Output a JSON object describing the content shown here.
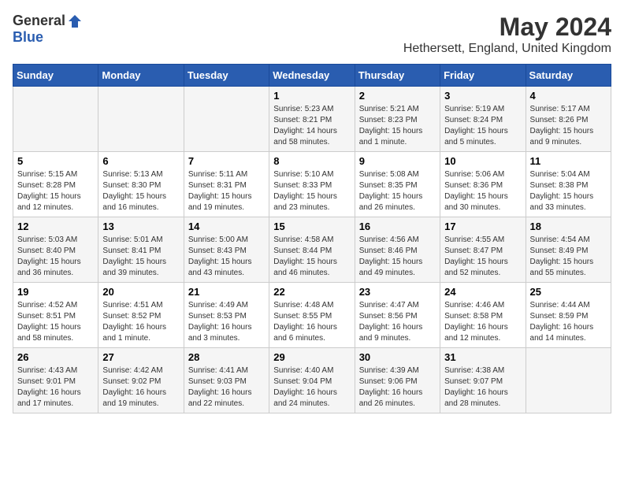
{
  "logo": {
    "general": "General",
    "blue": "Blue"
  },
  "title": "May 2024",
  "subtitle": "Hethersett, England, United Kingdom",
  "days_of_week": [
    "Sunday",
    "Monday",
    "Tuesday",
    "Wednesday",
    "Thursday",
    "Friday",
    "Saturday"
  ],
  "weeks": [
    [
      {
        "day": "",
        "detail": ""
      },
      {
        "day": "",
        "detail": ""
      },
      {
        "day": "",
        "detail": ""
      },
      {
        "day": "1",
        "detail": "Sunrise: 5:23 AM\nSunset: 8:21 PM\nDaylight: 14 hours and 58 minutes."
      },
      {
        "day": "2",
        "detail": "Sunrise: 5:21 AM\nSunset: 8:23 PM\nDaylight: 15 hours and 1 minute."
      },
      {
        "day": "3",
        "detail": "Sunrise: 5:19 AM\nSunset: 8:24 PM\nDaylight: 15 hours and 5 minutes."
      },
      {
        "day": "4",
        "detail": "Sunrise: 5:17 AM\nSunset: 8:26 PM\nDaylight: 15 hours and 9 minutes."
      }
    ],
    [
      {
        "day": "5",
        "detail": "Sunrise: 5:15 AM\nSunset: 8:28 PM\nDaylight: 15 hours and 12 minutes."
      },
      {
        "day": "6",
        "detail": "Sunrise: 5:13 AM\nSunset: 8:30 PM\nDaylight: 15 hours and 16 minutes."
      },
      {
        "day": "7",
        "detail": "Sunrise: 5:11 AM\nSunset: 8:31 PM\nDaylight: 15 hours and 19 minutes."
      },
      {
        "day": "8",
        "detail": "Sunrise: 5:10 AM\nSunset: 8:33 PM\nDaylight: 15 hours and 23 minutes."
      },
      {
        "day": "9",
        "detail": "Sunrise: 5:08 AM\nSunset: 8:35 PM\nDaylight: 15 hours and 26 minutes."
      },
      {
        "day": "10",
        "detail": "Sunrise: 5:06 AM\nSunset: 8:36 PM\nDaylight: 15 hours and 30 minutes."
      },
      {
        "day": "11",
        "detail": "Sunrise: 5:04 AM\nSunset: 8:38 PM\nDaylight: 15 hours and 33 minutes."
      }
    ],
    [
      {
        "day": "12",
        "detail": "Sunrise: 5:03 AM\nSunset: 8:40 PM\nDaylight: 15 hours and 36 minutes."
      },
      {
        "day": "13",
        "detail": "Sunrise: 5:01 AM\nSunset: 8:41 PM\nDaylight: 15 hours and 39 minutes."
      },
      {
        "day": "14",
        "detail": "Sunrise: 5:00 AM\nSunset: 8:43 PM\nDaylight: 15 hours and 43 minutes."
      },
      {
        "day": "15",
        "detail": "Sunrise: 4:58 AM\nSunset: 8:44 PM\nDaylight: 15 hours and 46 minutes."
      },
      {
        "day": "16",
        "detail": "Sunrise: 4:56 AM\nSunset: 8:46 PM\nDaylight: 15 hours and 49 minutes."
      },
      {
        "day": "17",
        "detail": "Sunrise: 4:55 AM\nSunset: 8:47 PM\nDaylight: 15 hours and 52 minutes."
      },
      {
        "day": "18",
        "detail": "Sunrise: 4:54 AM\nSunset: 8:49 PM\nDaylight: 15 hours and 55 minutes."
      }
    ],
    [
      {
        "day": "19",
        "detail": "Sunrise: 4:52 AM\nSunset: 8:51 PM\nDaylight: 15 hours and 58 minutes."
      },
      {
        "day": "20",
        "detail": "Sunrise: 4:51 AM\nSunset: 8:52 PM\nDaylight: 16 hours and 1 minute."
      },
      {
        "day": "21",
        "detail": "Sunrise: 4:49 AM\nSunset: 8:53 PM\nDaylight: 16 hours and 3 minutes."
      },
      {
        "day": "22",
        "detail": "Sunrise: 4:48 AM\nSunset: 8:55 PM\nDaylight: 16 hours and 6 minutes."
      },
      {
        "day": "23",
        "detail": "Sunrise: 4:47 AM\nSunset: 8:56 PM\nDaylight: 16 hours and 9 minutes."
      },
      {
        "day": "24",
        "detail": "Sunrise: 4:46 AM\nSunset: 8:58 PM\nDaylight: 16 hours and 12 minutes."
      },
      {
        "day": "25",
        "detail": "Sunrise: 4:44 AM\nSunset: 8:59 PM\nDaylight: 16 hours and 14 minutes."
      }
    ],
    [
      {
        "day": "26",
        "detail": "Sunrise: 4:43 AM\nSunset: 9:01 PM\nDaylight: 16 hours and 17 minutes."
      },
      {
        "day": "27",
        "detail": "Sunrise: 4:42 AM\nSunset: 9:02 PM\nDaylight: 16 hours and 19 minutes."
      },
      {
        "day": "28",
        "detail": "Sunrise: 4:41 AM\nSunset: 9:03 PM\nDaylight: 16 hours and 22 minutes."
      },
      {
        "day": "29",
        "detail": "Sunrise: 4:40 AM\nSunset: 9:04 PM\nDaylight: 16 hours and 24 minutes."
      },
      {
        "day": "30",
        "detail": "Sunrise: 4:39 AM\nSunset: 9:06 PM\nDaylight: 16 hours and 26 minutes."
      },
      {
        "day": "31",
        "detail": "Sunrise: 4:38 AM\nSunset: 9:07 PM\nDaylight: 16 hours and 28 minutes."
      },
      {
        "day": "",
        "detail": ""
      }
    ]
  ]
}
